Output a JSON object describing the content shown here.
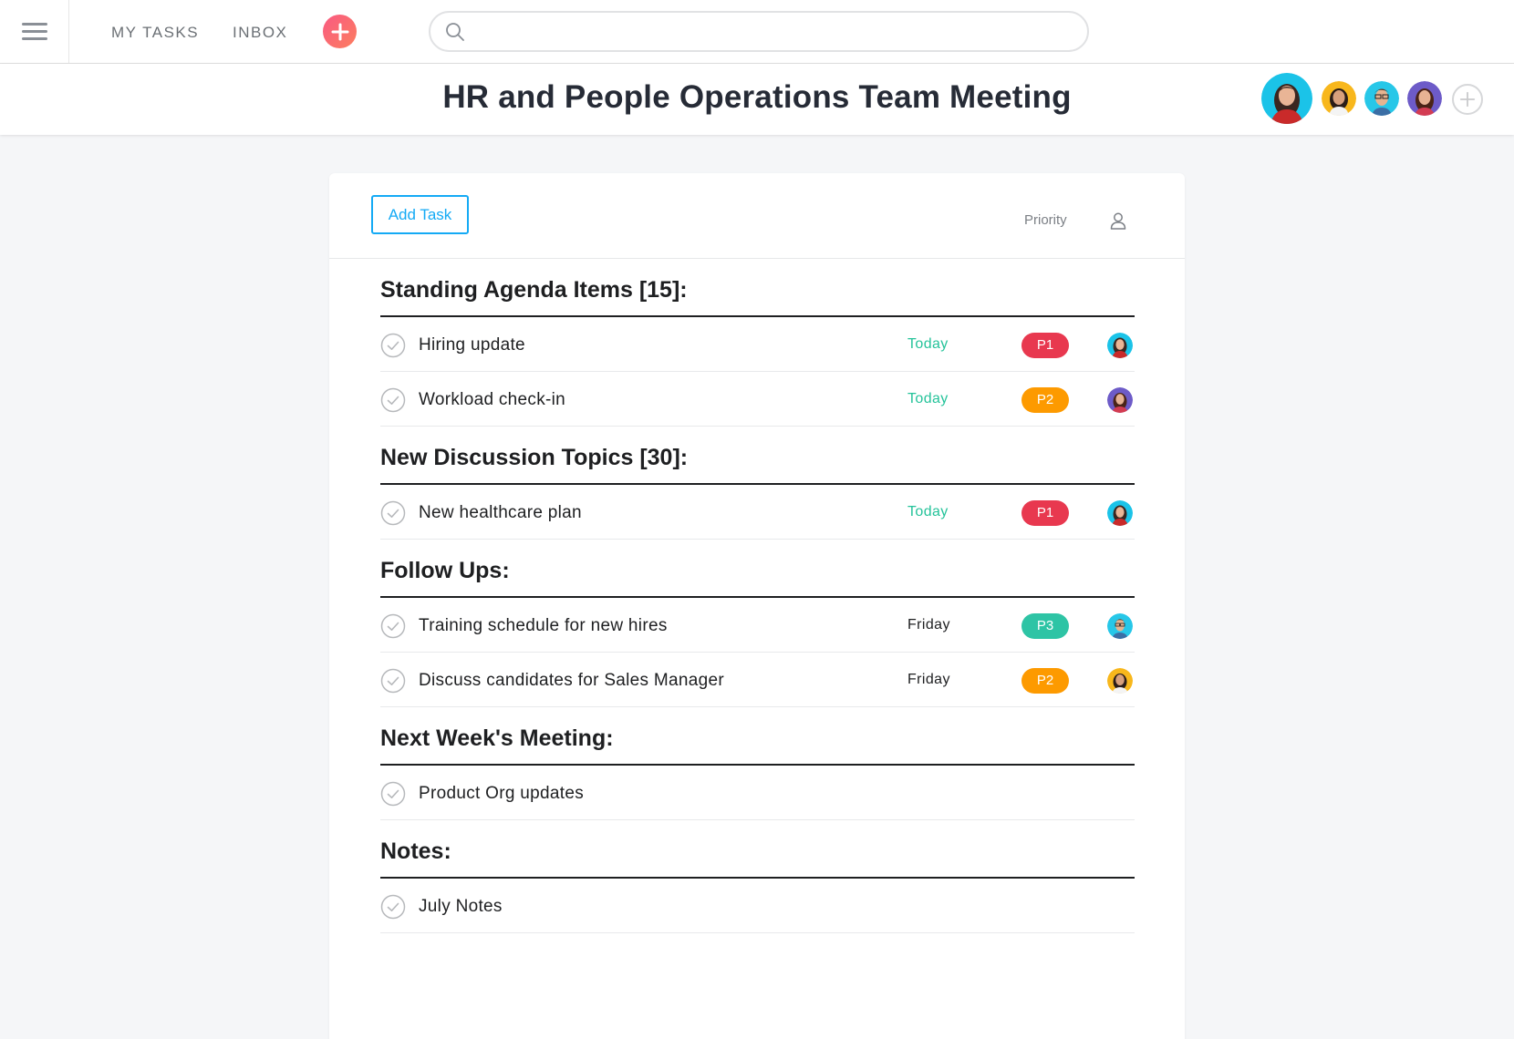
{
  "nav": {
    "my_tasks": "MY TASKS",
    "inbox": "INBOX",
    "search_placeholder": ""
  },
  "header": {
    "title": "HR and People Operations Team Meeting"
  },
  "toolbar": {
    "add_task": "Add Task",
    "priority_label": "Priority"
  },
  "colors": {
    "accent": "#14aaf5",
    "today": "#25c39a",
    "p1": "#e8384f",
    "p2": "#fd9a00",
    "p3": "#2ec4a5"
  },
  "sections": [
    {
      "title": "Standing Agenda Items [15]:",
      "tasks": [
        {
          "name": "Hiring update",
          "due": "Today",
          "priority": "P1",
          "assignee": "avatar-teal"
        },
        {
          "name": "Workload check-in",
          "due": "Today",
          "priority": "P2",
          "assignee": "avatar-purple"
        }
      ]
    },
    {
      "title": "New Discussion Topics [30]:",
      "tasks": [
        {
          "name": "New healthcare plan",
          "due": "Today",
          "priority": "P1",
          "assignee": "avatar-teal"
        }
      ]
    },
    {
      "title": "Follow Ups:",
      "tasks": [
        {
          "name": "Training schedule for new hires",
          "due": "Friday",
          "priority": "P3",
          "assignee": "avatar-glasses"
        },
        {
          "name": "Discuss candidates for Sales Manager",
          "due": "Friday",
          "priority": "P2",
          "assignee": "avatar-orange"
        }
      ]
    },
    {
      "title": "Next Week's Meeting:",
      "tasks": [
        {
          "name": "Product Org updates",
          "due": "",
          "priority": "",
          "assignee": ""
        }
      ]
    },
    {
      "title": "Notes:",
      "tasks": [
        {
          "name": "July Notes",
          "due": "",
          "priority": "",
          "assignee": ""
        }
      ]
    }
  ]
}
